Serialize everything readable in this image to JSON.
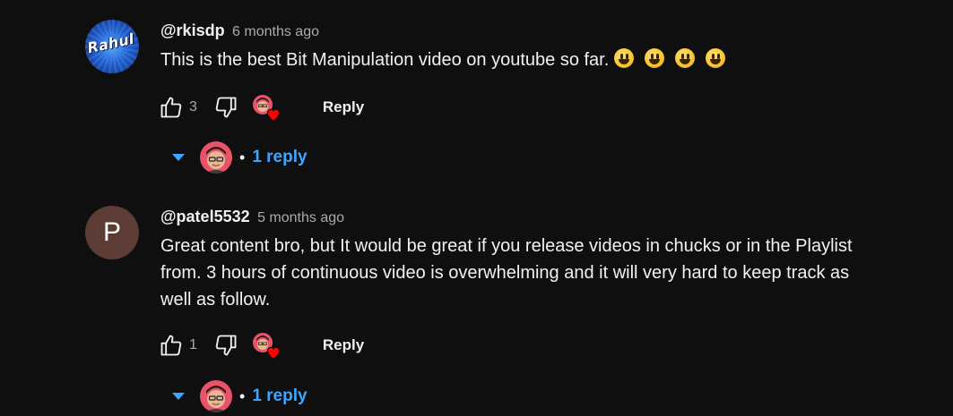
{
  "comments": [
    {
      "handle": "@rkisdp",
      "time": "6 months ago",
      "avatar_text": "Rahul",
      "text": "This is the best Bit Manipulation video on youtube so far.",
      "emojis": [
        "😃",
        "😃",
        "😃",
        "😃"
      ],
      "likes": "3",
      "reply_label": "Reply",
      "replies_label": "1 reply",
      "dot": "•"
    },
    {
      "handle": "@patel5532",
      "time": "5 months ago",
      "avatar_letter": "P",
      "text_lines": [
        "Great content bro, but It would be great if you release videos in chucks or in the Playlist",
        "from. 3 hours of continuous video is overwhelming and it will very hard to keep track as",
        "well as follow."
      ],
      "likes": "1",
      "reply_label": "Reply",
      "replies_label": "1 reply",
      "dot": "•"
    }
  ],
  "colors": {
    "background": "#0f0f0f",
    "link_blue": "#3ea6ff",
    "secondary_text": "#aaaaaa",
    "heart_red": "#ff0000"
  },
  "icons": [
    "thumbs-up-icon",
    "thumbs-down-icon",
    "creator-heart-icon",
    "caret-down-icon"
  ]
}
